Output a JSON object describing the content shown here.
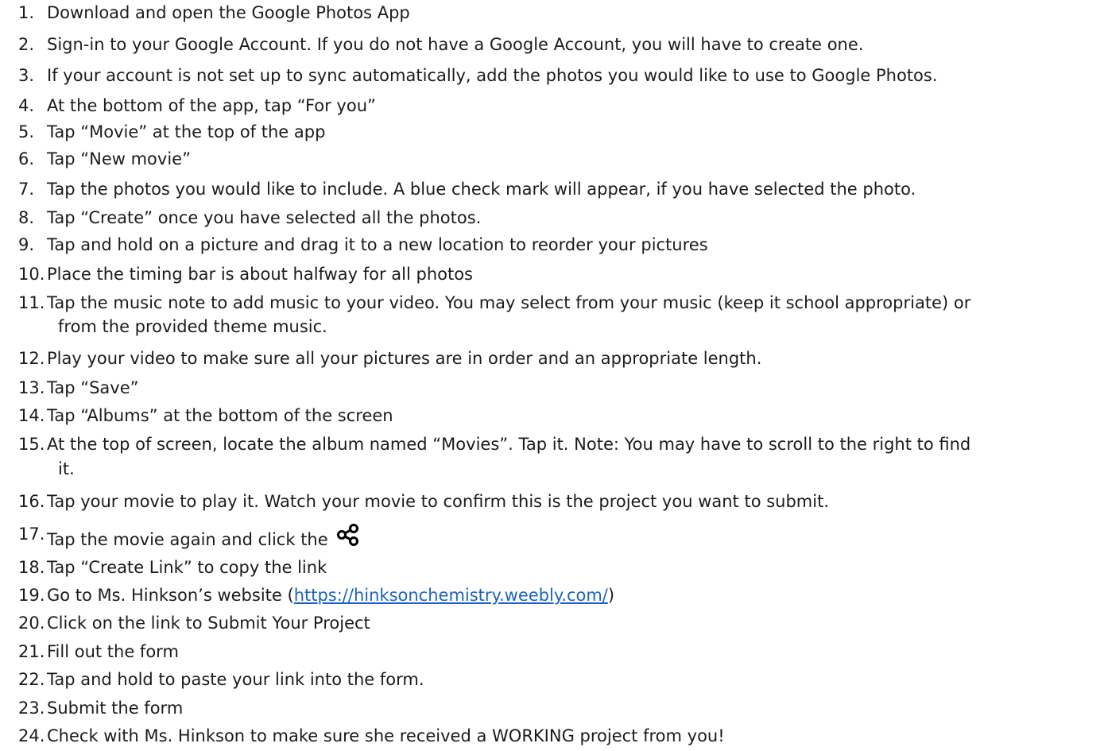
{
  "steps": [
    {
      "num": "1.",
      "text": "Download and open the Google Photos App"
    },
    {
      "num": "2.",
      "text": "Sign-in to your Google Account.  If you do not have a Google Account, you will have to create one."
    },
    {
      "num": "3.",
      "text": "If your account is not set up to sync automatically, add the photos you would like to use to Google Photos."
    },
    {
      "num": "4.",
      "text": "At the bottom of the app, tap “For you”"
    },
    {
      "num": "5.",
      "text": "Tap “Movie” at the top of the app"
    },
    {
      "num": "6.",
      "text": "Tap “New movie”"
    },
    {
      "num": "7.",
      "text": "Tap the photos you would like to include.  A blue check mark will appear, if you have selected the photo."
    },
    {
      "num": "8.",
      "text": "Tap “Create” once you have selected all the photos."
    },
    {
      "num": "9.",
      "text": "Tap and hold on a picture and drag it to a new location to reorder your pictures"
    },
    {
      "num": "10.",
      "text": "Place the timing bar is about halfway for all photos"
    },
    {
      "num": "11.",
      "text": "Tap the music note to add music to your video.  You may select from your music (keep it school appropriate) or",
      "cont": "from the provided theme music."
    },
    {
      "num": "12.",
      "text": "Play your video to make sure all your pictures are in order and an appropriate length."
    },
    {
      "num": "13.",
      "text": "Tap “Save”"
    },
    {
      "num": "14.",
      "text": "Tap “Albums” at the bottom of the screen"
    },
    {
      "num": "15.",
      "text": "At the top of screen, locate the album named “Movies”.  Tap it. Note: You may have to scroll to the right to find",
      "cont": "it."
    },
    {
      "num": "16.",
      "text": "Tap your movie to play it.  Watch your movie to confirm this is the project you want to submit."
    },
    {
      "num": "17.",
      "text": "Tap the movie again and click the",
      "icon": "share-icon"
    },
    {
      "num": "18.",
      "text": "Tap “Create Link” to copy the link"
    },
    {
      "num": "19.",
      "text_before": "Go to Ms. Hinkson’s website (",
      "link": "https://hinksonchemistry.weebly.com/",
      "text_after": ")"
    },
    {
      "num": "20.",
      "text": "Click on the link to Submit Your Project"
    },
    {
      "num": "21.",
      "text": "Fill out the form"
    },
    {
      "num": "22.",
      "text": "Tap and hold to paste your link into the form."
    },
    {
      "num": "23.",
      "text": "Submit the form"
    },
    {
      "num": "24.",
      "text": "Check with Ms. Hinkson to make sure she received a WORKING project from you!"
    }
  ],
  "colors": {
    "text": "#1b1b1b",
    "link": "#1a63c2",
    "background": "#ffffff"
  }
}
